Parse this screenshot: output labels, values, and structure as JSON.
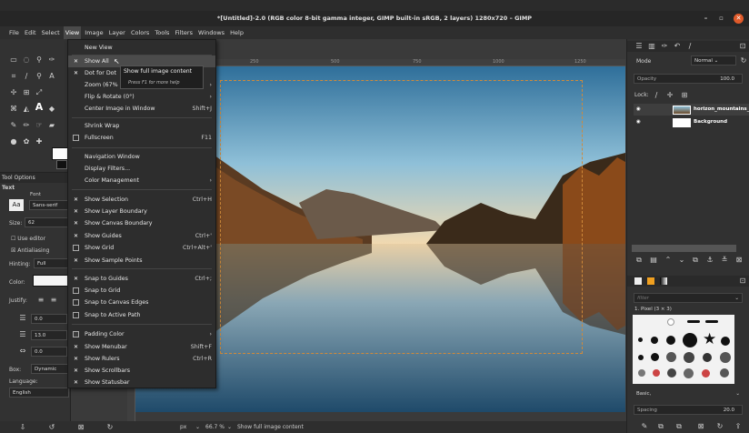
{
  "window": {
    "title": "*[Untitled]-2.0 (RGB color 8-bit gamma integer, GIMP built-in sRGB, 2 layers) 1280x720 – GIMP",
    "minimize": "–",
    "maximize": "▫",
    "close": "✕"
  },
  "menubar": [
    "File",
    "Edit",
    "Select",
    "View",
    "Image",
    "Layer",
    "Colors",
    "Tools",
    "Filters",
    "Windows",
    "Help"
  ],
  "view_menu": {
    "new_view": "New View",
    "show_all": "Show All",
    "dot_for_dot": "Dot for Dot",
    "zoom": "Zoom (67%",
    "flip_rotate": "Flip & Rotate (0°)",
    "center_image": "Center Image in Window",
    "center_image_shortcut": "Shift+J",
    "shrink_wrap": "Shrink Wrap",
    "fullscreen": "Fullscreen",
    "fullscreen_shortcut": "F11",
    "navigation_window": "Navigation Window",
    "display_filters": "Display Filters...",
    "color_management": "Color Management",
    "show_selection": "Show Selection",
    "show_selection_shortcut": "Ctrl+H",
    "show_layer_boundary": "Show Layer Boundary",
    "show_canvas_boundary": "Show Canvas Boundary",
    "show_guides": "Show Guides",
    "show_guides_shortcut": "Ctrl+'",
    "show_grid": "Show Grid",
    "show_grid_shortcut": "Ctrl+Alt+'",
    "show_sample_points": "Show Sample Points",
    "snap_to_guides": "Snap to Guides",
    "snap_to_guides_shortcut": "Ctrl+;",
    "snap_to_grid": "Snap to Grid",
    "snap_to_canvas_edges": "Snap to Canvas Edges",
    "snap_to_active_path": "Snap to Active Path",
    "padding_color": "Padding Color",
    "show_menubar": "Show Menubar",
    "show_menubar_shortcut": "Shift+F",
    "show_rulers": "Show Rulers",
    "show_rulers_shortcut": "Ctrl+R",
    "show_scrollbars": "Show Scrollbars",
    "show_statusbar": "Show Statusbar"
  },
  "tooltip": {
    "text": "Show full image content",
    "hint": "Press F1 for more help"
  },
  "tool_options": {
    "header": "Tool Options",
    "section": "Text",
    "font_label": "Font",
    "font_value": "Sans-serif",
    "size_label": "Size:",
    "size_value": "62",
    "use_editor": "Use editor",
    "antialiasing": "Antialiasing",
    "hinting_label": "Hinting:",
    "hinting_value": "Full",
    "color_label": "Color:",
    "justify_label": "Justify:",
    "indent_value": "0.0",
    "line_spacing_value": "13.0",
    "letter_spacing_value": "0.0",
    "box_label": "Box:",
    "box_value": "Dynamic",
    "language_label": "Language:",
    "language_value": "English"
  },
  "ruler_marks": [
    "250",
    "500",
    "750",
    "1000",
    "1250"
  ],
  "statusbar": {
    "unit": "px",
    "zoom": "66.7 %",
    "message": "Show full image content"
  },
  "layers_panel": {
    "mode_label": "Mode",
    "mode_value": "Normal",
    "opacity_label": "Opacity",
    "opacity_value": "100.0",
    "lock_label": "Lock:",
    "layers": [
      "horizon_mountains_",
      "Background"
    ]
  },
  "brushes_panel": {
    "filter_placeholder": "filter",
    "brush_name": "1. Pixel (3 × 3)",
    "preset": "Basic,",
    "spacing_label": "Spacing",
    "spacing_value": "20.0"
  },
  "colors": {
    "accent_close": "#e05a2a",
    "selection_dash": "#d08a3a"
  }
}
